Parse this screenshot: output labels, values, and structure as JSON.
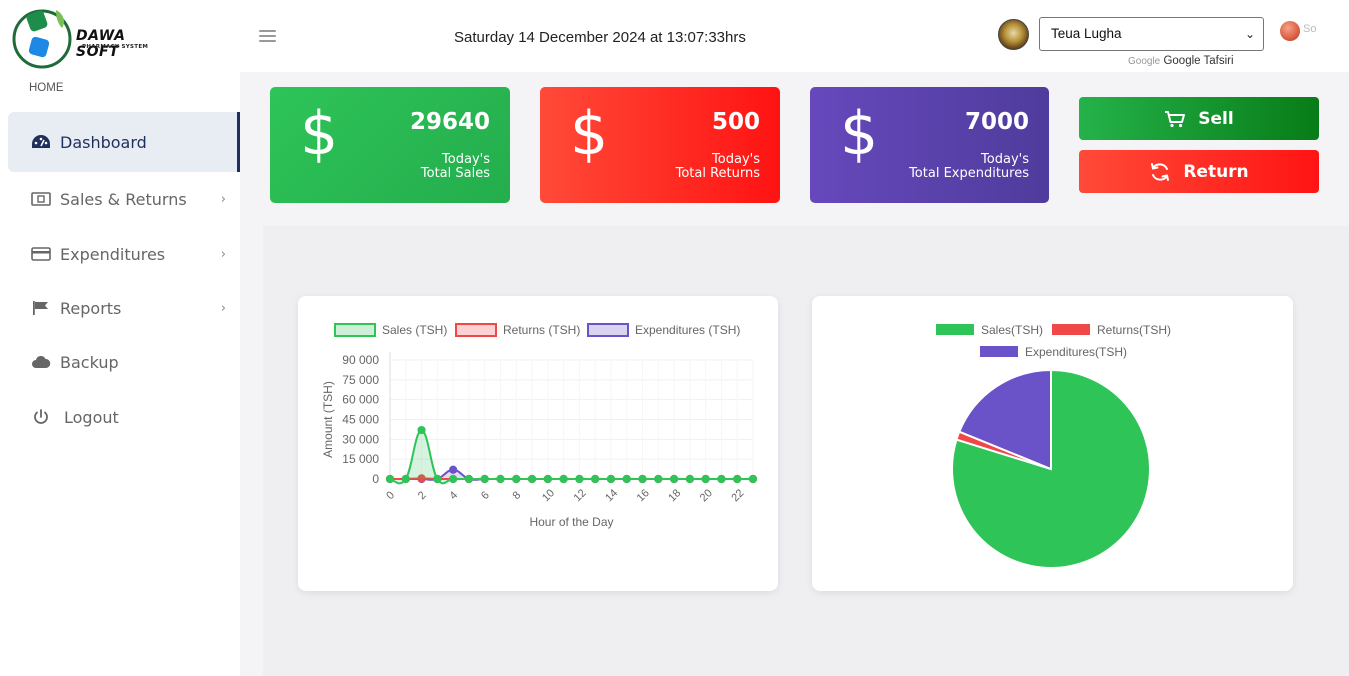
{
  "brand": {
    "name": "DAWA SOFT",
    "subtitle": "PHARMACY SYSTEM"
  },
  "header": {
    "datetime": "Saturday 14 December 2024 at 13:07:33hrs",
    "language_select": {
      "value": "Teua Lugha"
    },
    "powered_by_prefix": "Google",
    "powered_by": "Google Tafsiri",
    "lang_code": "So"
  },
  "sidebar": {
    "home_label": "HOME",
    "items": [
      {
        "label": "Dashboard",
        "icon": "dashboard-icon",
        "active": true
      },
      {
        "label": "Sales & Returns",
        "icon": "money-icon",
        "has_submenu": true
      },
      {
        "label": "Expenditures",
        "icon": "credit-card-icon",
        "has_submenu": true
      },
      {
        "label": "Reports",
        "icon": "flag-icon",
        "has_submenu": true
      },
      {
        "label": "Backup",
        "icon": "cloud-icon"
      },
      {
        "label": "Logout",
        "icon": "power-icon"
      }
    ]
  },
  "cards": [
    {
      "value": "29640",
      "label_line1": "Today's",
      "label_line2": "Total Sales",
      "icon": "dollar-icon",
      "color": "#2ec458"
    },
    {
      "value": "500",
      "label_line1": "Today's",
      "label_line2": "Total Returns",
      "icon": "dollar-icon",
      "color": "#ff2a20"
    },
    {
      "value": "7000",
      "label_line1": "Today's",
      "label_line2": "Total Expenditures",
      "icon": "dollar-icon",
      "color": "#5a44ac"
    }
  ],
  "actions": {
    "sell_label": "Sell",
    "return_label": "Return"
  },
  "colors": {
    "sales": "#2ec458",
    "returns": "#f04848",
    "expenditures": "#6a52c8",
    "active_nav": "#1f2f5e"
  },
  "chart_data": [
    {
      "type": "line",
      "xlabel": "Hour of the Day",
      "ylabel": "Amount (TSH)",
      "ylim": [
        0,
        90000
      ],
      "yticks": [
        "0",
        "15 000",
        "30 000",
        "45 000",
        "60 000",
        "75 000",
        "90 000"
      ],
      "xticks": [
        "0",
        "2",
        "4",
        "6",
        "8",
        "10",
        "12",
        "14",
        "16",
        "18",
        "20",
        "22"
      ],
      "x": [
        0,
        1,
        2,
        3,
        4,
        5,
        6,
        7,
        8,
        9,
        10,
        11,
        12,
        13,
        14,
        15,
        16,
        17,
        18,
        19,
        20,
        21,
        22,
        23
      ],
      "legend_position": "top",
      "series": [
        {
          "name": "Sales (TSH)",
          "color": "#2ec458",
          "values": [
            0,
            0,
            37000,
            0,
            0,
            0,
            0,
            0,
            0,
            0,
            0,
            0,
            0,
            0,
            0,
            0,
            0,
            0,
            0,
            0,
            0,
            0,
            0,
            0
          ]
        },
        {
          "name": "Returns (TSH)",
          "color": "#f04848",
          "values": [
            0,
            0,
            500,
            0,
            0,
            0,
            0,
            0,
            0,
            0,
            0,
            0,
            0,
            0,
            0,
            0,
            0,
            0,
            0,
            0,
            0,
            0,
            0,
            0
          ]
        },
        {
          "name": "Expenditures (TSH)",
          "color": "#6a52c8",
          "values": [
            0,
            0,
            0,
            0,
            7000,
            0,
            0,
            0,
            0,
            0,
            0,
            0,
            0,
            0,
            0,
            0,
            0,
            0,
            0,
            0,
            0,
            0,
            0,
            0
          ]
        }
      ]
    },
    {
      "type": "pie",
      "legend_position": "top",
      "categories": [
        "Sales(TSH)",
        "Returns(TSH)",
        "Expenditures(TSH)"
      ],
      "values": [
        29640,
        500,
        7000
      ],
      "colors": [
        "#2ec458",
        "#f04848",
        "#6a52c8"
      ]
    }
  ]
}
